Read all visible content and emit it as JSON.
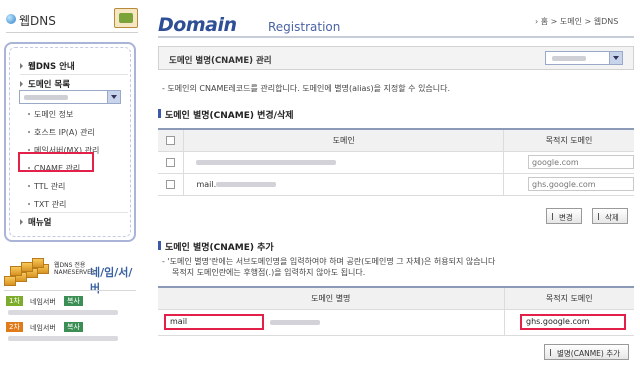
{
  "sidebar": {
    "logo_text": "웹DNS",
    "menu": {
      "webdns_info": "웹DNS 안내",
      "domain_list": "도메인 목록",
      "sub": {
        "domain_info": "도메인 정보",
        "host_ip": "호스트 IP(A) 관리",
        "mail_mx": "메일서버(MX) 관리",
        "cname": "CNAME 관리",
        "ttl": "TTL 관리",
        "txt": "TXT 관리"
      },
      "manual": "매뉴얼"
    },
    "nameserver": {
      "small_label": "웹DNS 전용",
      "small_label_en": "NAMESERVER",
      "big_label": "네/임/서/버",
      "primary_num": "1차",
      "primary_label": "네임서버",
      "secondary_num": "2차",
      "secondary_label": "네임서버",
      "copy_label": "복사"
    }
  },
  "header": {
    "title": "Domain",
    "title_sub": "Registration",
    "breadcrumb": "› 홈 > 도메인 > 웹DNS"
  },
  "main": {
    "bar_title": "도메인 별명(CNAME) 관리",
    "description": "- 도메인의 CNAME레코드를 관리합니다. 도메인에 별명(alias)을 지정할 수 있습니다.",
    "edit_section": {
      "title": "도메인 별명(CNAME) 변경/삭제",
      "col_domain": "도메인",
      "col_target": "목적지 도메인",
      "rows": [
        {
          "domain_prefix": "",
          "target_placeholder": "google.com"
        },
        {
          "domain_prefix": "mail.",
          "target_placeholder": "ghs.google.com"
        }
      ],
      "change_button": "변경",
      "delete_button": "삭제"
    },
    "add_section": {
      "title": "도메인 별명(CNAME) 추가",
      "note_line1": "- '도메인 별명'란에는 서브도메인명을 입력하여야 하며 공란(도메인명 그 자체)은 허용되지 않습니다",
      "note_line2": "목적지 도메인란에는 후행점(.)을 입력하지 않아도 됩니다.",
      "col_alias": "도메인 별명",
      "col_target": "목적지 도메인",
      "alias_value": "mail",
      "target_value": "ghs.google.com",
      "add_button": "별명(CANME) 추가"
    }
  },
  "colors": {
    "accent_blue": "#2e4e96",
    "highlight_red": "#e2204a",
    "sidebar_border": "#a9b4d6"
  }
}
